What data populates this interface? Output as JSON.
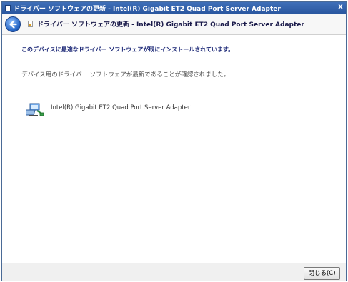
{
  "window": {
    "title": "ドライバー ソフトウェアの更新 - Intel(R) Gigabit ET2 Quad Port Server Adapter",
    "close_glyph": "x"
  },
  "nav": {
    "back_icon": "back-arrow-icon",
    "title": "ドライバー ソフトウェアの更新 - Intel(R) Gigabit ET2 Quad Port Server Adapter"
  },
  "content": {
    "headline": "このデバイスに最適なドライバー ソフトウェアが既にインストールされています。",
    "description": "デバイス用のドライバー ソフトウェアが最新であることが確認されました。",
    "device": {
      "icon": "network-adapter-icon",
      "name": "Intel(R) Gigabit ET2 Quad Port Server Adapter"
    }
  },
  "footer": {
    "close_label": "閉じる(",
    "close_mnemonic": "C",
    "close_label_end": ")"
  }
}
